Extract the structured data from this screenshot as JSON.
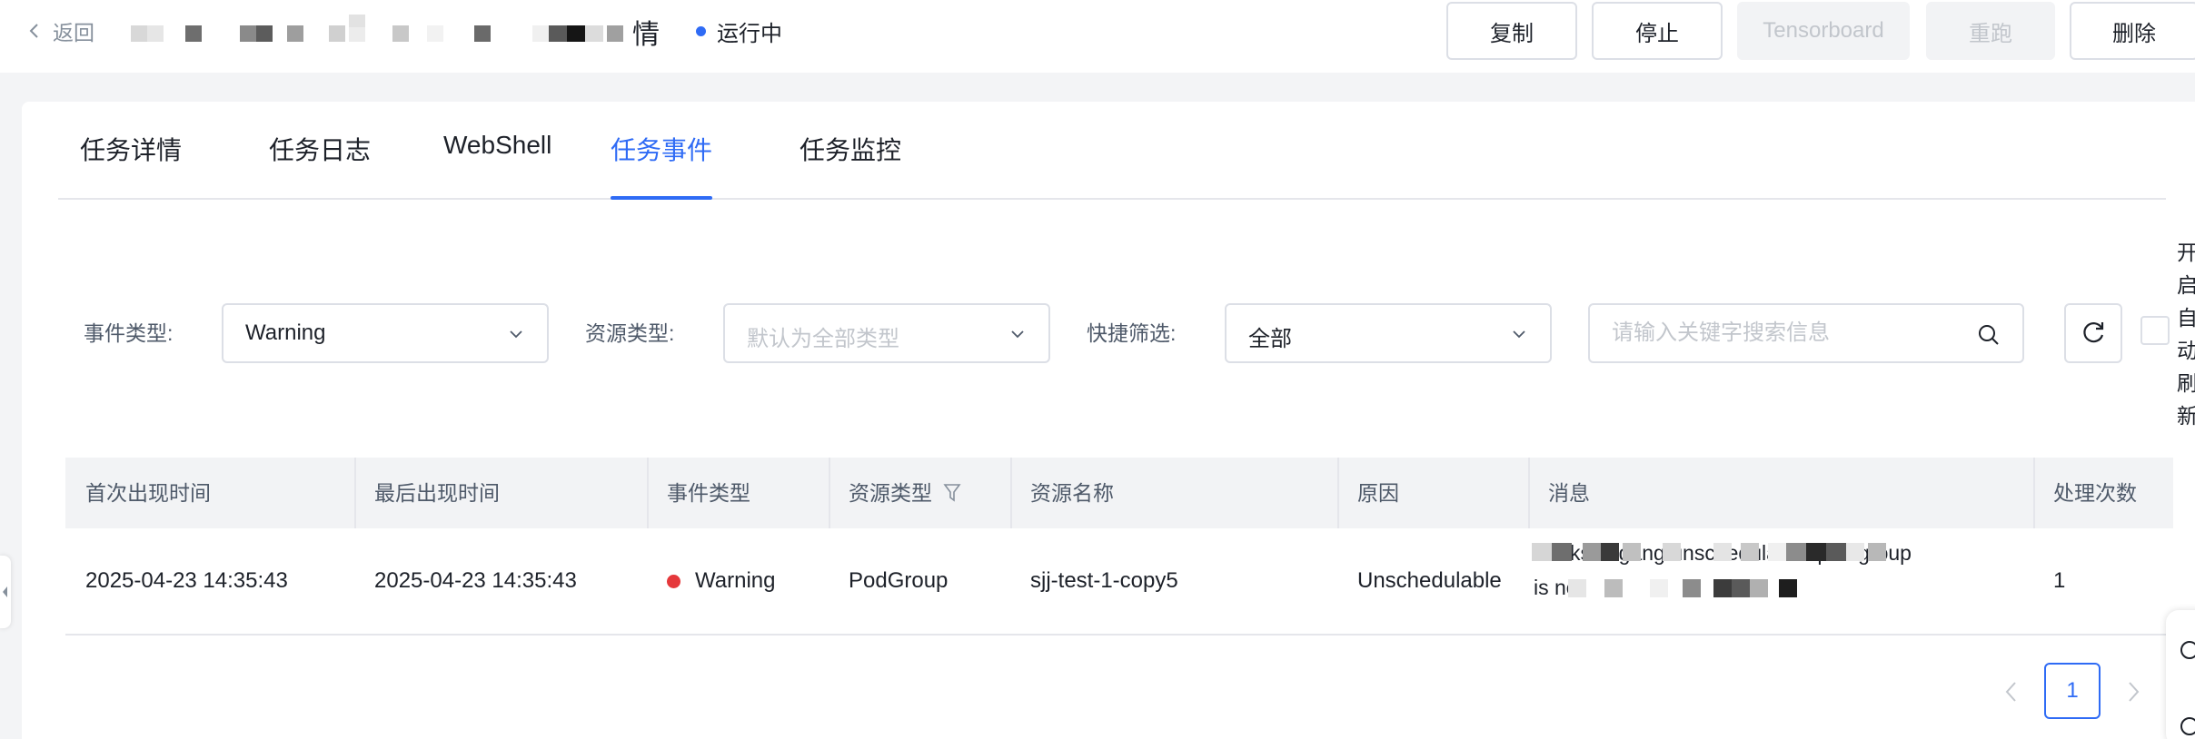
{
  "header": {
    "back_label": "返回",
    "title_visible": "情",
    "status": "运行中",
    "status_color": "#2f6bf5",
    "buttons": {
      "copy": "复制",
      "stop": "停止",
      "tensorboard": "Tensorboard",
      "rerun": "重跑",
      "delete": "删除"
    }
  },
  "tabs": [
    "任务详情",
    "任务日志",
    "WebShell",
    "任务事件",
    "任务监控"
  ],
  "active_tab": "任务事件",
  "filters": {
    "event_type_label": "事件类型:",
    "event_type_value": "Warning",
    "resource_type_label": "资源类型:",
    "resource_type_placeholder": "默认为全部类型",
    "quick_filter_label": "快捷筛选:",
    "quick_filter_value": "全部",
    "search_placeholder": "请输入关键字搜索信息",
    "auto_refresh_label": "开启自动刷新"
  },
  "table": {
    "columns": [
      "首次出现时间",
      "最后出现时间",
      "事件类型",
      "资源类型",
      "资源名称",
      "原因",
      "消息",
      "处理次数"
    ],
    "rows": [
      {
        "first_seen": "2025-04-23 14:35:43",
        "last_seen": "2025-04-23 14:35:43",
        "event_type": "Warning",
        "resource_type": "PodGroup",
        "resource_name": "sjj-test-1-copy5",
        "reason": "Unschedulable",
        "message_line1": "ks in gang unschedulable: pod group",
        "message_line2": "is not",
        "count": "1"
      }
    ]
  },
  "pagination": {
    "current_page": "1"
  },
  "colors": {
    "accent": "#2f6bf5",
    "warning_dot": "#e5383b"
  }
}
